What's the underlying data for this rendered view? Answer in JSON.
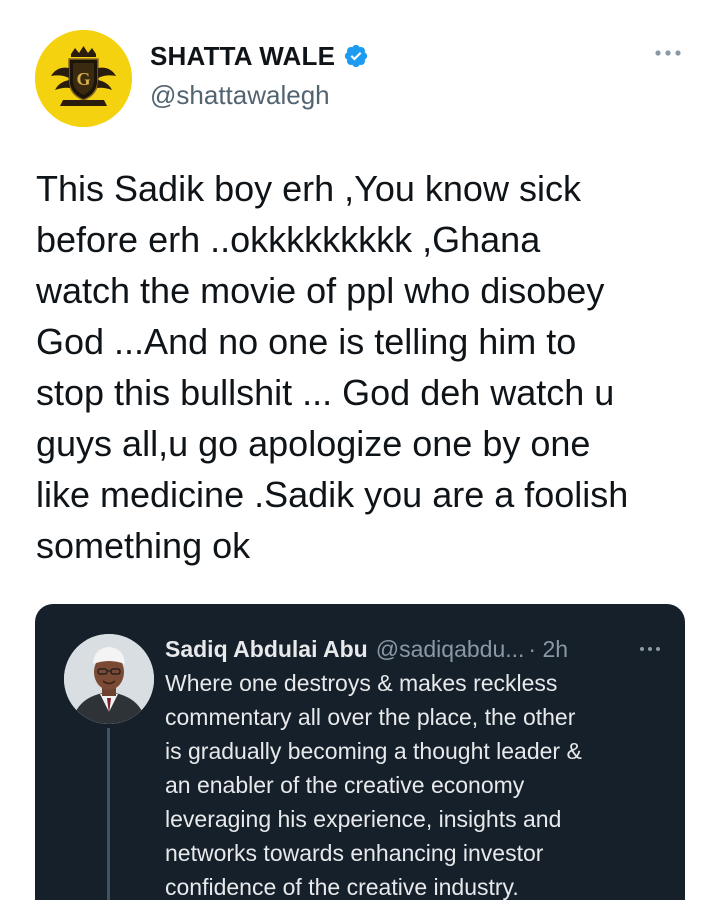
{
  "tweet": {
    "author": {
      "display_name": "SHATTA WALE",
      "handle": "@shattawalegh",
      "verified": true,
      "avatar_icon": "gold-crest-logo",
      "avatar_color": "#f5d20f"
    },
    "more_icon": "more-horizontal-icon",
    "text": "This Sadik boy erh ,You know sick\nbefore erh ..okkkkkkkkk ,Ghana\nwatch the movie of ppl who disobey\nGod ...And no one is telling him to\nstop this bullshit ... God deh watch u\nguys all,u go apologize one by one\nlike medicine .Sadik you are a foolish\nsomething ok"
  },
  "quoted_tweet": {
    "author_name": "Sadiq Abdulai Abu",
    "handle": "@sadiqabdu...",
    "time": "· 2h",
    "text": "Where one destroys & makes reckless\ncommentary all over the place, the other\nis gradually becoming a thought leader &\nan enabler of the creative economy\nleveraging his experience, insights and\nnetworks towards enhancing investor\nconfidence of the creative industry.",
    "background_color": "#15202b"
  },
  "colors": {
    "verified_badge": "#1d9bf0",
    "text_primary": "#0f1419",
    "text_secondary": "#536471"
  }
}
